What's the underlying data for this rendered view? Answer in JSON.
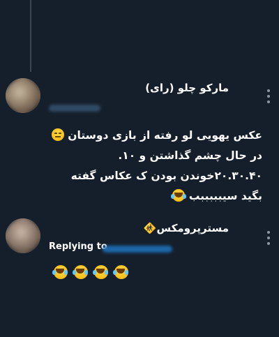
{
  "tweet": {
    "author_name": "مارکو چلو (رای)",
    "text_lines": [
      "عکس یهویی لو رفته از بازی دوستان",
      "در حال چشم گذاشتن و ۱۰.",
      "۲۰.۳۰.۴۰خوندن بودن ک عکاس گفته",
      "بگید سیبببببب"
    ],
    "line_emojis": [
      "expressionless-face-icon",
      "",
      "",
      "face-with-tears-of-joy-icon"
    ]
  },
  "reply": {
    "author_name": "مستر‌پرومکس🚸",
    "replying_label": "Replying to",
    "emoji_count": 4,
    "emoji_icon": "face-with-tears-of-joy-icon"
  },
  "colors": {
    "background": "#151f2b",
    "text": "#ffffff",
    "secondary": "#8b98a5",
    "accent": "#1d9bf0"
  }
}
